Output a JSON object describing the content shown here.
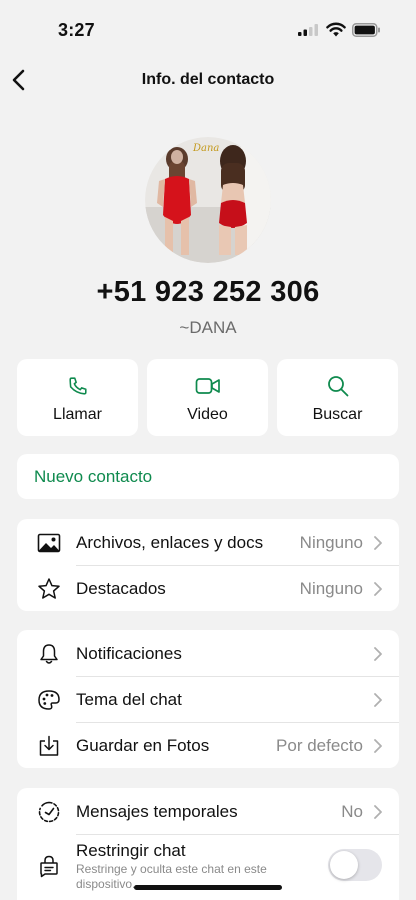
{
  "status": {
    "time": "3:27"
  },
  "nav": {
    "title": "Info. del contacto"
  },
  "profile": {
    "avatar_caption": "Dana",
    "phone": "+51 923 252 306",
    "alias": "~DANA"
  },
  "actions": [
    {
      "label": "Llamar",
      "icon": "phone-icon"
    },
    {
      "label": "Video",
      "icon": "video-icon"
    },
    {
      "label": "Buscar",
      "icon": "search-icon"
    }
  ],
  "new_contact": {
    "label": "Nuevo contacto"
  },
  "media_group": {
    "items": [
      {
        "label": "Archivos, enlaces y docs",
        "value": "Ninguno",
        "icon": "image-icon"
      },
      {
        "label": "Destacados",
        "value": "Ninguno",
        "icon": "star-icon"
      }
    ]
  },
  "settings_group": {
    "items": [
      {
        "label": "Notificaciones",
        "value": "",
        "icon": "bell-icon"
      },
      {
        "label": "Tema del chat",
        "value": "",
        "icon": "palette-icon"
      },
      {
        "label": "Guardar en Fotos",
        "value": "Por defecto",
        "icon": "download-icon"
      }
    ]
  },
  "privacy_group": {
    "items": [
      {
        "label": "Mensajes temporales",
        "value": "No",
        "icon": "timer-icon"
      },
      {
        "label": "Restringir chat",
        "sublabel": "Restringe y oculta este chat en este dispositivo.",
        "icon": "lock-chat-icon",
        "toggle_on": false
      }
    ]
  },
  "colors": {
    "accent": "#0f8a4e",
    "background": "#f2f2f2"
  }
}
